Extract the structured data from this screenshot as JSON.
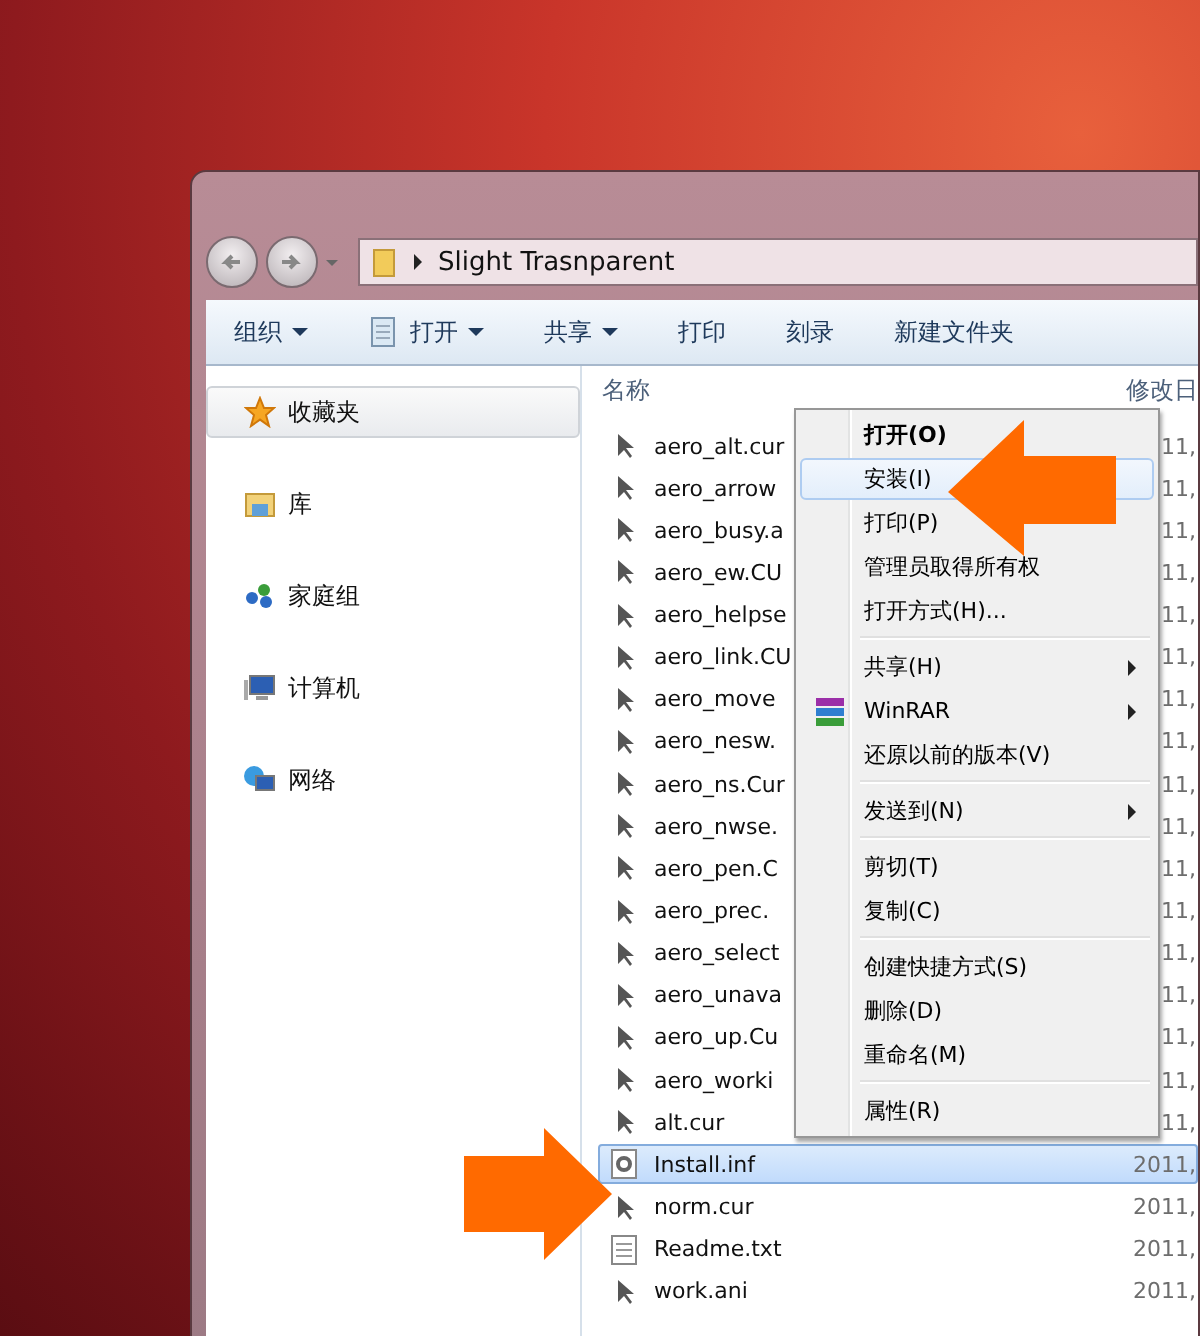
{
  "address_bar": {
    "path": "Slight Trasnparent"
  },
  "toolbar": [
    {
      "label": "组织",
      "dropdown": true,
      "kind": "plain"
    },
    {
      "label": "打开",
      "dropdown": true,
      "kind": "open"
    },
    {
      "label": "共享",
      "dropdown": true,
      "kind": "plain"
    },
    {
      "label": "打印",
      "dropdown": false,
      "kind": "plain"
    },
    {
      "label": "刻录",
      "dropdown": false,
      "kind": "plain"
    },
    {
      "label": "新建文件夹",
      "dropdown": false,
      "kind": "plain"
    }
  ],
  "sidebar": {
    "items": [
      {
        "label": "收藏夹",
        "kind": "favorites",
        "selected": true
      },
      {
        "label": "库",
        "kind": "libraries",
        "selected": false
      },
      {
        "label": "家庭组",
        "kind": "homegroup",
        "selected": false
      },
      {
        "label": "计算机",
        "kind": "computer",
        "selected": false
      },
      {
        "label": "网络",
        "kind": "network",
        "selected": false
      }
    ]
  },
  "file_list": {
    "columns": [
      "名称",
      "修改日"
    ],
    "rows": [
      {
        "name": "aero_alt.cur",
        "date": "11,",
        "kind": "cursor",
        "selected": false
      },
      {
        "name": "aero_arrow",
        "date": "11,",
        "kind": "cursor",
        "selected": false
      },
      {
        "name": "aero_busy.a",
        "date": "11,",
        "kind": "cursor",
        "selected": false
      },
      {
        "name": "aero_ew.CU",
        "date": "11,",
        "kind": "cursor",
        "selected": false
      },
      {
        "name": "aero_helpse",
        "date": "11,",
        "kind": "cursor",
        "selected": false
      },
      {
        "name": "aero_link.CU",
        "date": "11,",
        "kind": "cursor",
        "selected": false
      },
      {
        "name": "aero_move",
        "date": "11,",
        "kind": "cursor",
        "selected": false
      },
      {
        "name": "aero_nesw.",
        "date": "11,",
        "kind": "cursor",
        "selected": false
      },
      {
        "name": "aero_ns.Cur",
        "date": "11,",
        "kind": "cursor",
        "selected": false
      },
      {
        "name": "aero_nwse.",
        "date": "11,",
        "kind": "cursor",
        "selected": false
      },
      {
        "name": "aero_pen.C",
        "date": "11,",
        "kind": "cursor",
        "selected": false
      },
      {
        "name": "aero_prec.",
        "date": "11,",
        "kind": "cursor",
        "selected": false
      },
      {
        "name": "aero_select",
        "date": "11,",
        "kind": "cursor",
        "selected": false
      },
      {
        "name": "aero_unava",
        "date": "11,",
        "kind": "cursor",
        "selected": false
      },
      {
        "name": "aero_up.Cu",
        "date": "11,",
        "kind": "cursor",
        "selected": false
      },
      {
        "name": "aero_worki",
        "date": "11,",
        "kind": "cursor",
        "selected": false
      },
      {
        "name": "alt.cur",
        "date": "11,",
        "kind": "cursor",
        "selected": false
      },
      {
        "name": "Install.inf",
        "date": "2011,",
        "kind": "settings",
        "selected": true
      },
      {
        "name": "norm.cur",
        "date": "2011,",
        "kind": "cursor",
        "selected": false
      },
      {
        "name": "Readme.txt",
        "date": "2011,",
        "kind": "document",
        "selected": false
      },
      {
        "name": "work.ani",
        "date": "2011,",
        "kind": "cursor",
        "selected": false
      }
    ]
  },
  "context_menu": [
    {
      "kind": "item",
      "label": "打开(O)",
      "default": true,
      "selected": false,
      "submenu": false
    },
    {
      "kind": "item",
      "label": "安装(I)",
      "default": false,
      "selected": true,
      "submenu": false
    },
    {
      "kind": "item",
      "label": "打印(P)",
      "default": false,
      "selected": false,
      "submenu": false
    },
    {
      "kind": "item",
      "label": "管理员取得所有权",
      "default": false,
      "selected": false,
      "submenu": false
    },
    {
      "kind": "item",
      "label": "打开方式(H)...",
      "default": false,
      "selected": false,
      "submenu": false
    },
    {
      "kind": "separator"
    },
    {
      "kind": "item",
      "label": "共享(H)",
      "default": false,
      "selected": false,
      "submenu": true
    },
    {
      "kind": "winrar",
      "label": "WinRAR",
      "default": false,
      "selected": false,
      "submenu": true
    },
    {
      "kind": "item",
      "label": "还原以前的版本(V)",
      "default": false,
      "selected": false,
      "submenu": false
    },
    {
      "kind": "separator"
    },
    {
      "kind": "item",
      "label": "发送到(N)",
      "default": false,
      "selected": false,
      "submenu": true
    },
    {
      "kind": "separator"
    },
    {
      "kind": "item",
      "label": "剪切(T)",
      "default": false,
      "selected": false,
      "submenu": false
    },
    {
      "kind": "item",
      "label": "复制(C)",
      "default": false,
      "selected": false,
      "submenu": false
    },
    {
      "kind": "separator"
    },
    {
      "kind": "item",
      "label": "创建快捷方式(S)",
      "default": false,
      "selected": false,
      "submenu": false
    },
    {
      "kind": "item",
      "label": "删除(D)",
      "default": false,
      "selected": false,
      "submenu": false
    },
    {
      "kind": "item",
      "label": "重命名(M)",
      "default": false,
      "selected": false,
      "submenu": false
    },
    {
      "kind": "separator"
    },
    {
      "kind": "item",
      "label": "属性(R)",
      "default": false,
      "selected": false,
      "submenu": false
    }
  ]
}
